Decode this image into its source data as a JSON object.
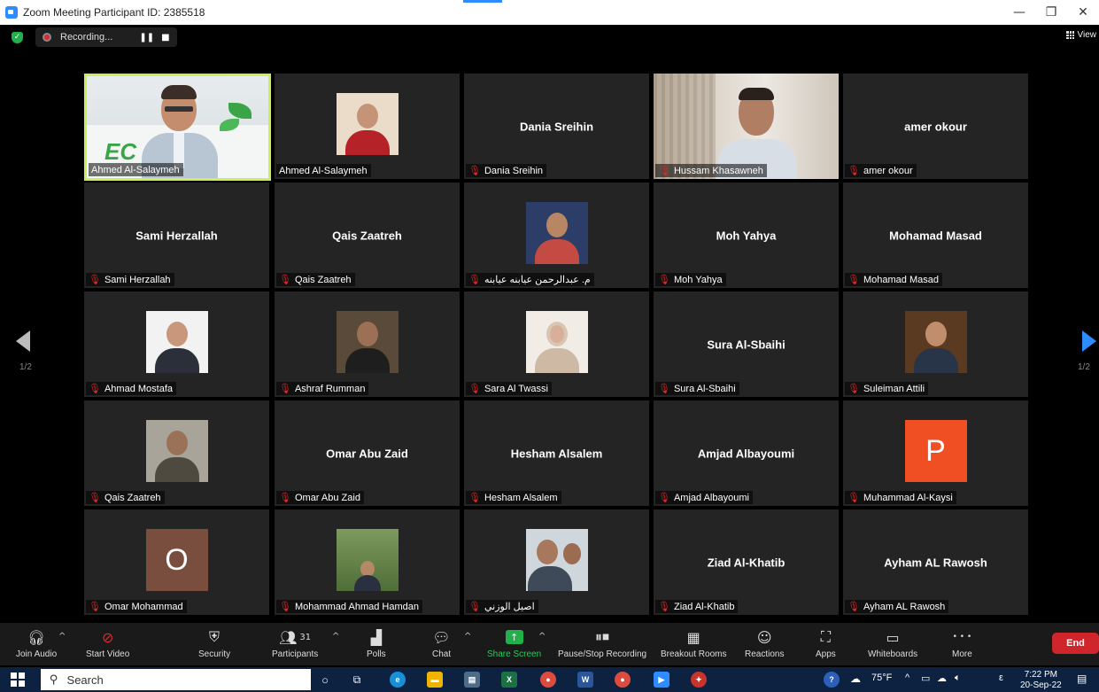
{
  "window": {
    "title": "Zoom Meeting Participant ID: 2385518",
    "minimize": "—",
    "restore": "❐",
    "close": "✕"
  },
  "topbar": {
    "recording_label": "Recording...",
    "pause": "❚❚",
    "stop": "■",
    "view_label": "View"
  },
  "pagination": {
    "left": "1/2",
    "right": "1/2"
  },
  "tiles": [
    {
      "label": "Ahmed Al-Salaymeh",
      "big": "",
      "muted": false
    },
    {
      "label": "Ahmed Al-Salaymeh",
      "big": "",
      "muted": false
    },
    {
      "label": "Dania Sreihin",
      "big": "Dania Sreihin",
      "muted": true
    },
    {
      "label": "Hussam Khasawneh",
      "big": "",
      "muted": true
    },
    {
      "label": "amer okour",
      "big": "amer okour",
      "muted": true
    },
    {
      "label": "Sami Herzallah",
      "big": "Sami Herzallah",
      "muted": true
    },
    {
      "label": "Qais Zaatreh",
      "big": "Qais Zaatreh",
      "muted": true
    },
    {
      "label": "م. عبدالرحمن عيابنه عيابنه",
      "big": "",
      "muted": true
    },
    {
      "label": "Moh Yahya",
      "big": "Moh Yahya",
      "muted": true
    },
    {
      "label": "Mohamad Masad",
      "big": "Mohamad Masad",
      "muted": true
    },
    {
      "label": "Ahmad Mostafa",
      "big": "",
      "muted": true
    },
    {
      "label": "Ashraf Rumman",
      "big": "",
      "muted": true
    },
    {
      "label": "Sara Al Twassi",
      "big": "",
      "muted": true
    },
    {
      "label": "Sura Al-Sbaihi",
      "big": "Sura Al-Sbaihi",
      "muted": true
    },
    {
      "label": "Suleiman Attili",
      "big": "",
      "muted": true
    },
    {
      "label": "Qais Zaatreh",
      "big": "",
      "muted": true
    },
    {
      "label": "Omar Abu Zaid",
      "big": "Omar Abu Zaid",
      "muted": true
    },
    {
      "label": "Hesham Alsalem",
      "big": "Hesham Alsalem",
      "muted": true
    },
    {
      "label": "Amjad Albayoumi",
      "big": "Amjad Albayoumi",
      "muted": true
    },
    {
      "label": "Muhammad Al-Kaysi",
      "big": "",
      "muted": true
    },
    {
      "label": "Omar Mohammad",
      "big": "",
      "muted": true
    },
    {
      "label": "Mohammad Ahmad Hamdan",
      "big": "",
      "muted": true
    },
    {
      "label": "اصيل الوزني",
      "big": "",
      "muted": true
    },
    {
      "label": "Ziad Al-Khatib",
      "big": "Ziad Al-Khatib",
      "muted": true
    },
    {
      "label": "Ayham AL Rawosh",
      "big": "Ayham AL Rawosh",
      "muted": true
    }
  ],
  "avatars": {
    "muhammad_letter": "P",
    "omar_letter": "O"
  },
  "toolbar": {
    "join_audio": "Join Audio",
    "start_video": "Start Video",
    "security": "Security",
    "participants": "Participants",
    "participants_count": "31",
    "polls": "Polls",
    "chat": "Chat",
    "share_screen": "Share Screen",
    "pause_stop_recording": "Pause/Stop Recording",
    "breakout_rooms": "Breakout Rooms",
    "reactions": "Reactions",
    "apps": "Apps",
    "whiteboards": "Whiteboards",
    "more": "More",
    "more_dots": "• • •",
    "end": "End"
  },
  "taskbar": {
    "search": "Search",
    "weather": "75°F",
    "time": "7:22 PM",
    "date": "20-Sep-22"
  }
}
